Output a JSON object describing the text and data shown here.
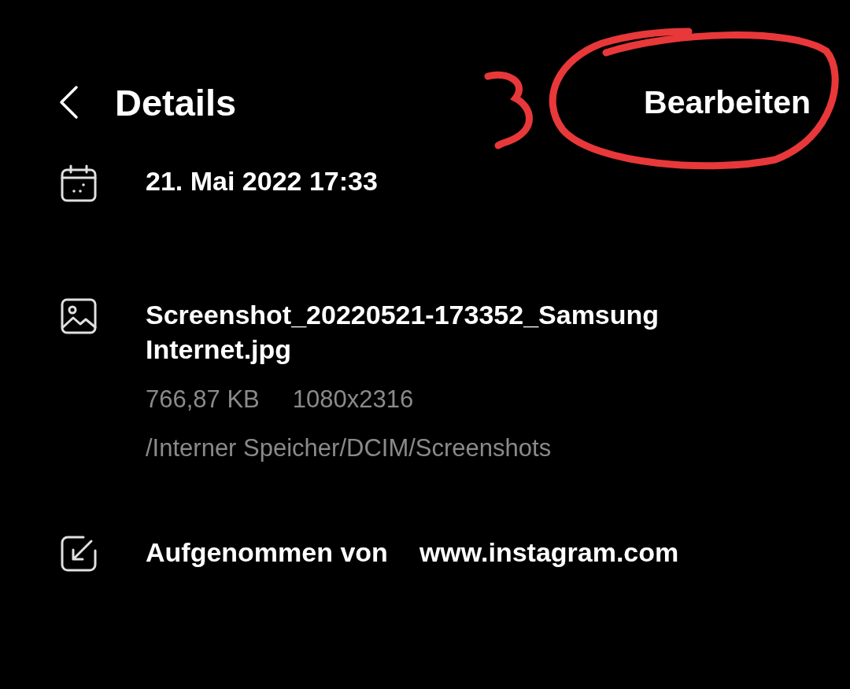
{
  "header": {
    "title": "Details",
    "action": "Bearbeiten"
  },
  "details": [
    {
      "kind": "date",
      "text": "21. Mai 2022 17:33"
    },
    {
      "kind": "file",
      "text": "Screenshot_20220521-173352_Samsung Internet.jpg",
      "size": "766,87 KB",
      "resolution": "1080x2316",
      "path": "/Interner Speicher/DCIM/Screenshots"
    },
    {
      "kind": "source",
      "label": "Aufgenommen von",
      "text": "www.instagram.com"
    }
  ]
}
